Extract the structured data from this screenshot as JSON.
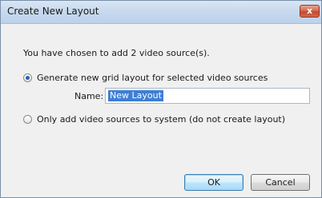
{
  "dialog": {
    "title": "Create New Layout",
    "close_glyph": "x",
    "message": "You have chosen to add 2 video source(s).",
    "option_generate": {
      "label": "Generate new grid layout for selected video sources",
      "checked": true
    },
    "name_field": {
      "label": "Name:",
      "value": "New Layout"
    },
    "option_add_only": {
      "label": "Only add video sources to system (do not create layout)",
      "checked": false
    },
    "ok_label": "OK",
    "cancel_label": "Cancel"
  }
}
